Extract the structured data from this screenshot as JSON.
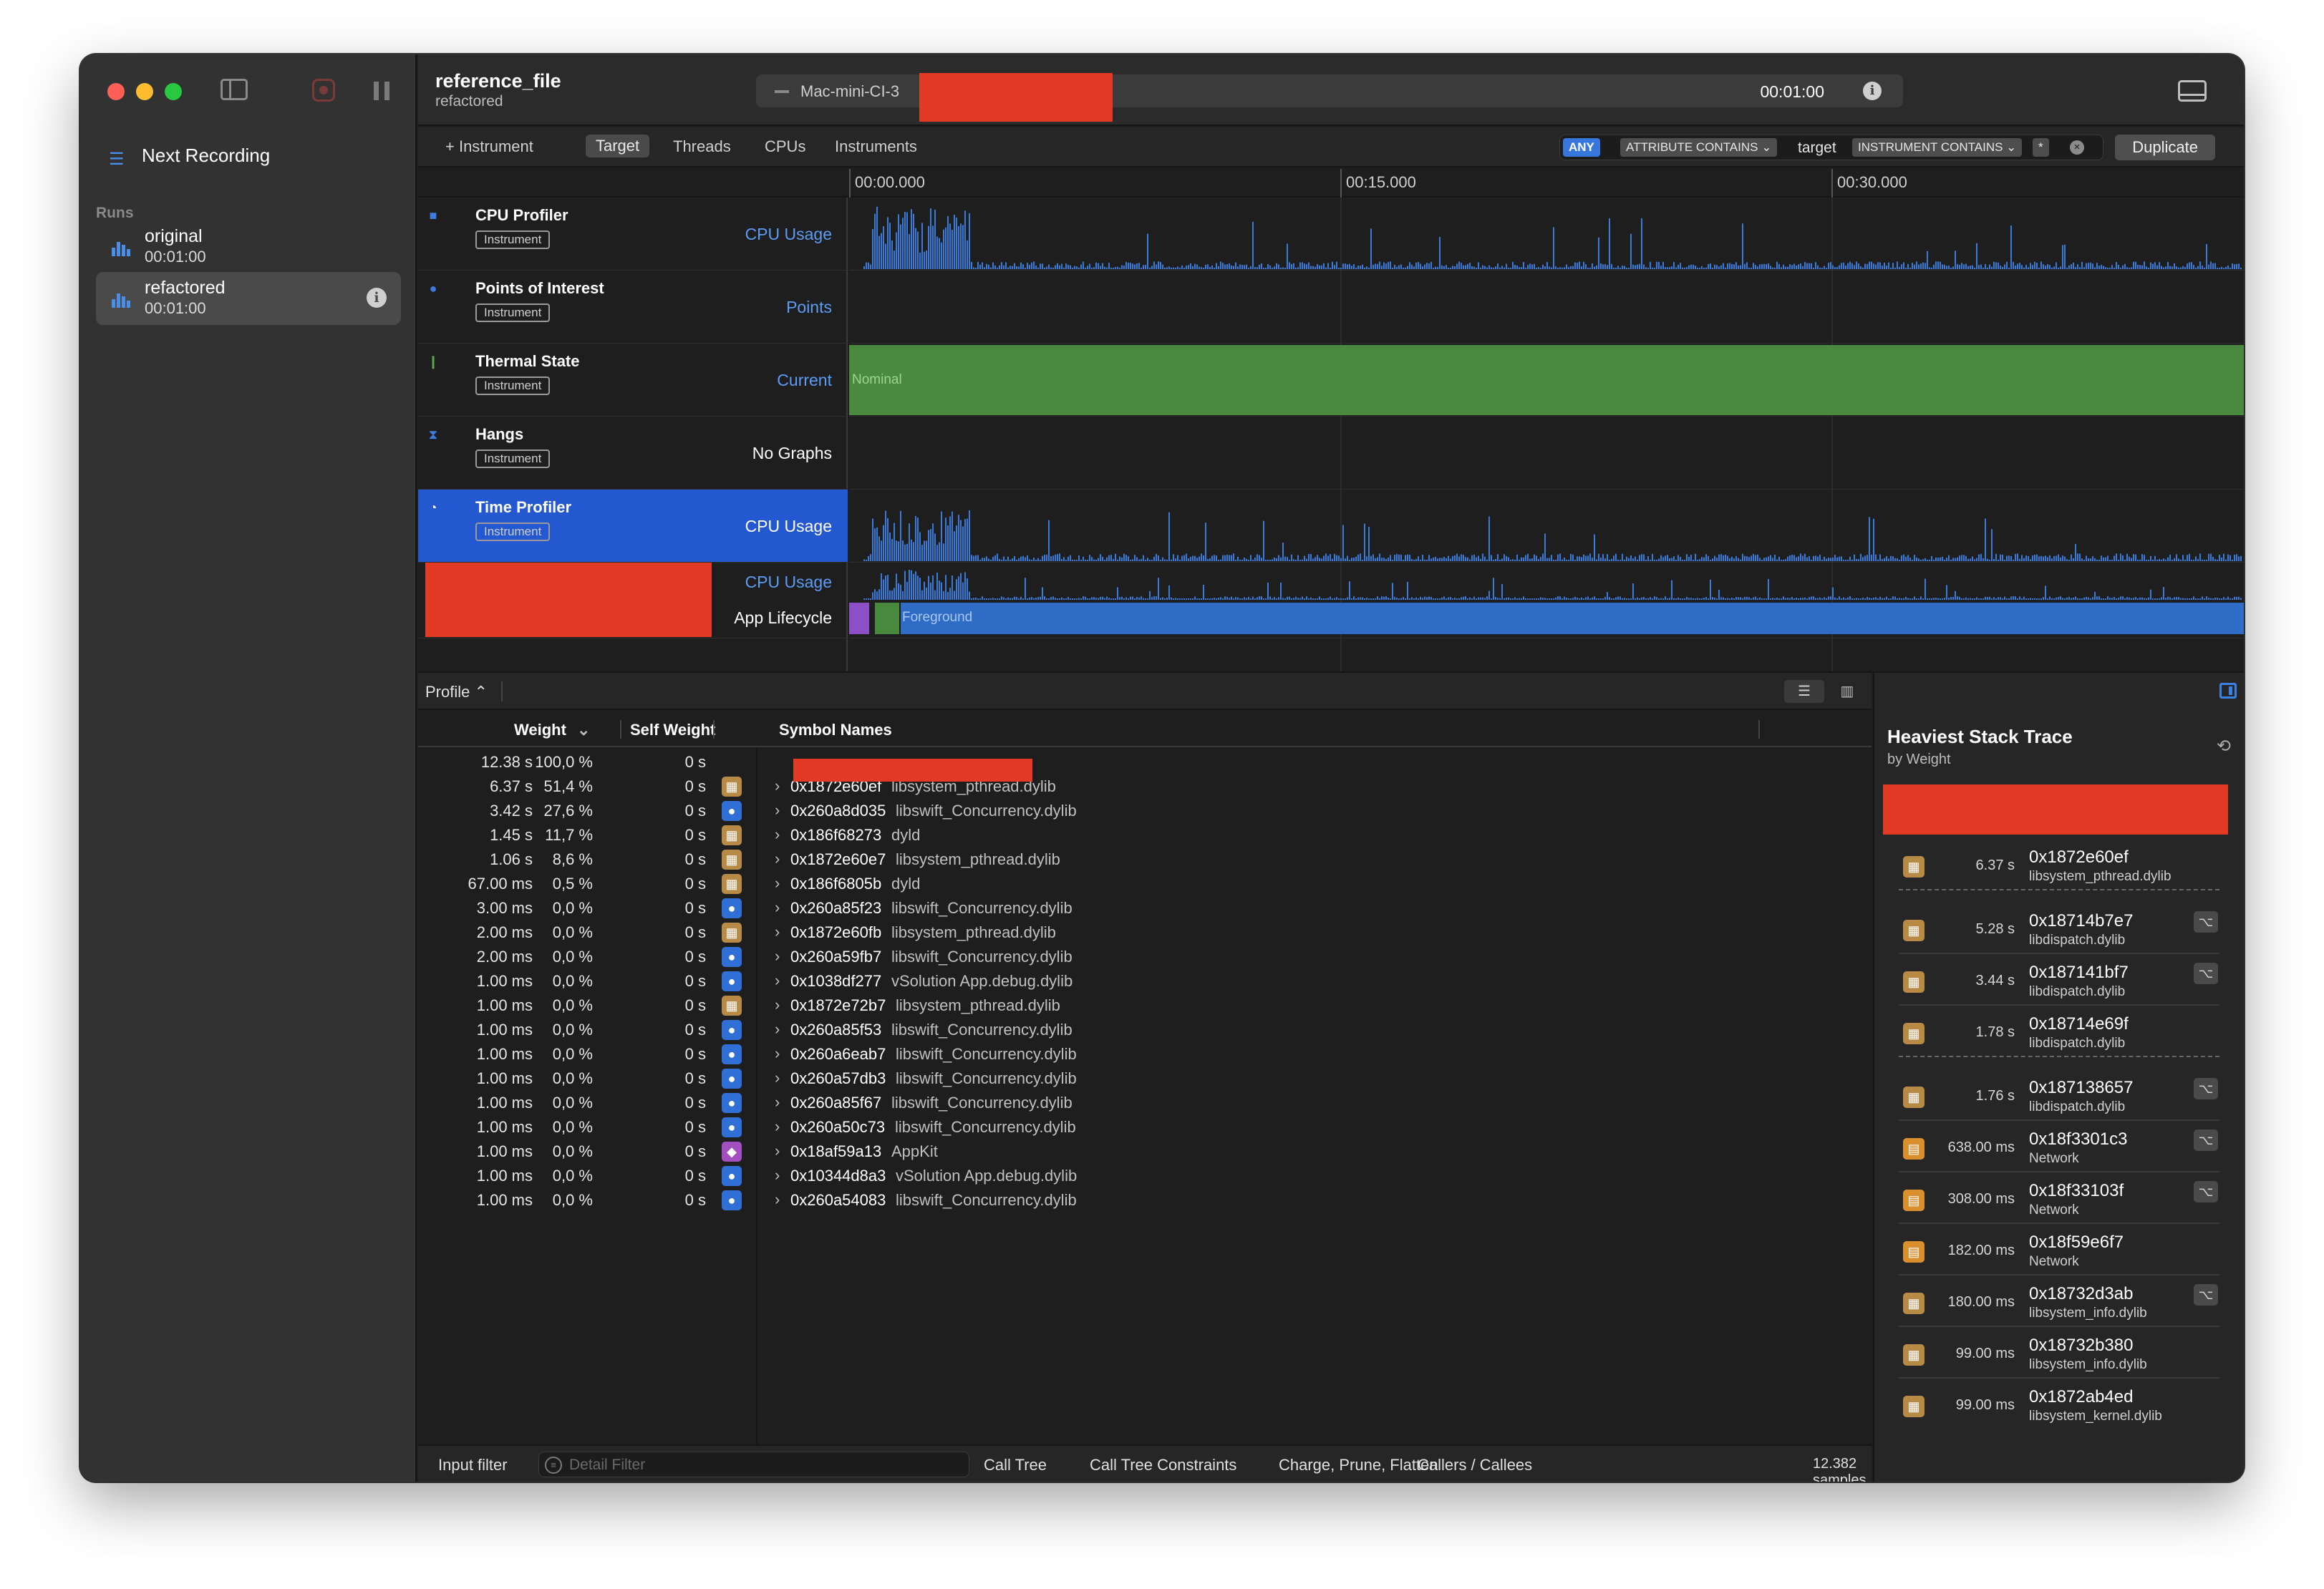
{
  "window": {
    "document_title": "reference_file",
    "document_subtitle": "refactored",
    "device": "Mac-mini-CI-3",
    "elapsed": "00:01:00",
    "info_glyph": "i"
  },
  "sidebar": {
    "next_recording": "Next Recording",
    "runs_header": "Runs",
    "runs": [
      {
        "name": "original",
        "time": "00:01:00"
      },
      {
        "name": "refactored",
        "time": "00:01:00"
      }
    ]
  },
  "toolbar": {
    "add_instrument": "+ Instrument",
    "tabs": [
      "Target",
      "Threads",
      "CPUs",
      "Instruments"
    ],
    "filter": {
      "any": "ANY",
      "attribute": "ATTRIBUTE CONTAINS ⌄",
      "value": "target",
      "instrument": "INSTRUMENT CONTAINS ⌄",
      "wildcard": "*"
    },
    "duplicate": "Duplicate"
  },
  "timeline": {
    "ticks": [
      "00:00.000",
      "00:15.000",
      "00:30.000"
    ],
    "tracks": [
      {
        "name": "CPU Profiler",
        "tag": "Instrument",
        "graph": "CPU Usage",
        "icon": "cpu-profiler-icon",
        "color": "#3c7ce0"
      },
      {
        "name": "Points of Interest",
        "tag": "Instrument",
        "graph": "Points",
        "icon": "map-pin-icon",
        "color": "#3c7ce0"
      },
      {
        "name": "Thermal State",
        "tag": "Instrument",
        "graph": "Current",
        "icon": "thermometer-icon",
        "color": "#5aa84a"
      },
      {
        "name": "Hangs",
        "tag": "Instrument",
        "graph": "No Graphs",
        "icon": "hourglass-icon",
        "color": "#3c7ce0"
      },
      {
        "name": "Time Profiler",
        "tag": "Instrument",
        "graph": "CPU Usage",
        "icon": "clock-icon",
        "color": "#ffffff"
      }
    ],
    "process_track": {
      "graph1": "CPU Usage",
      "graph2": "App Lifecycle"
    },
    "thermal_label": "Nominal",
    "lifecycle_label": "Foreground"
  },
  "profile": {
    "selector": "Profile ⌃",
    "columns": {
      "weight": "Weight",
      "self_weight": "Self Weight",
      "symbol": "Symbol Names"
    },
    "rows": [
      {
        "weight": "12.38 s",
        "pct": "100,0 %",
        "self": "0 s",
        "icon": "none",
        "addr": "",
        "lib": ""
      },
      {
        "weight": "6.37 s",
        "pct": "51,4 %",
        "self": "0 s",
        "icon": "lib",
        "addr": "0x1872e60ef",
        "lib": "libsystem_pthread.dylib"
      },
      {
        "weight": "3.42 s",
        "pct": "27,6 %",
        "self": "0 s",
        "icon": "user",
        "addr": "0x260a8d035",
        "lib": "libswift_Concurrency.dylib"
      },
      {
        "weight": "1.45 s",
        "pct": "11,7 %",
        "self": "0 s",
        "icon": "lib",
        "addr": "0x186f68273",
        "lib": "dyld"
      },
      {
        "weight": "1.06 s",
        "pct": "8,6 %",
        "self": "0 s",
        "icon": "lib",
        "addr": "0x1872e60e7",
        "lib": "libsystem_pthread.dylib"
      },
      {
        "weight": "67.00 ms",
        "pct": "0,5 %",
        "self": "0 s",
        "icon": "lib",
        "addr": "0x186f6805b",
        "lib": "dyld"
      },
      {
        "weight": "3.00 ms",
        "pct": "0,0 %",
        "self": "0 s",
        "icon": "user",
        "addr": "0x260a85f23",
        "lib": "libswift_Concurrency.dylib"
      },
      {
        "weight": "2.00 ms",
        "pct": "0,0 %",
        "self": "0 s",
        "icon": "lib",
        "addr": "0x1872e60fb",
        "lib": "libsystem_pthread.dylib"
      },
      {
        "weight": "2.00 ms",
        "pct": "0,0 %",
        "self": "0 s",
        "icon": "user",
        "addr": "0x260a59fb7",
        "lib": "libswift_Concurrency.dylib"
      },
      {
        "weight": "1.00 ms",
        "pct": "0,0 %",
        "self": "0 s",
        "icon": "user",
        "addr": "0x1038df277",
        "lib": "vSolution App.debug.dylib"
      },
      {
        "weight": "1.00 ms",
        "pct": "0,0 %",
        "self": "0 s",
        "icon": "lib",
        "addr": "0x1872e72b7",
        "lib": "libsystem_pthread.dylib"
      },
      {
        "weight": "1.00 ms",
        "pct": "0,0 %",
        "self": "0 s",
        "icon": "user",
        "addr": "0x260a85f53",
        "lib": "libswift_Concurrency.dylib"
      },
      {
        "weight": "1.00 ms",
        "pct": "0,0 %",
        "self": "0 s",
        "icon": "user",
        "addr": "0x260a6eab7",
        "lib": "libswift_Concurrency.dylib"
      },
      {
        "weight": "1.00 ms",
        "pct": "0,0 %",
        "self": "0 s",
        "icon": "user",
        "addr": "0x260a57db3",
        "lib": "libswift_Concurrency.dylib"
      },
      {
        "weight": "1.00 ms",
        "pct": "0,0 %",
        "self": "0 s",
        "icon": "user",
        "addr": "0x260a85f67",
        "lib": "libswift_Concurrency.dylib"
      },
      {
        "weight": "1.00 ms",
        "pct": "0,0 %",
        "self": "0 s",
        "icon": "user",
        "addr": "0x260a50c73",
        "lib": "libswift_Concurrency.dylib"
      },
      {
        "weight": "1.00 ms",
        "pct": "0,0 %",
        "self": "0 s",
        "icon": "kit",
        "addr": "0x18af59a13",
        "lib": "AppKit"
      },
      {
        "weight": "1.00 ms",
        "pct": "0,0 %",
        "self": "0 s",
        "icon": "user",
        "addr": "0x10344d8a3",
        "lib": "vSolution App.debug.dylib"
      },
      {
        "weight": "1.00 ms",
        "pct": "0,0 %",
        "self": "0 s",
        "icon": "user",
        "addr": "0x260a54083",
        "lib": "libswift_Concurrency.dylib"
      }
    ]
  },
  "bottom_bar": {
    "input_filter": "Input filter",
    "detail_placeholder": "Detail Filter",
    "call_tree": "Call Tree",
    "constraints": "Call Tree Constraints",
    "charge": "Charge, Prune, Flatten",
    "callers": "Callers / Callees",
    "samples": "12.382 samples"
  },
  "inspector": {
    "title": "Heaviest Stack Trace",
    "subtitle": "by Weight",
    "frames": [
      {
        "time": "6.37 s",
        "addr": "0x1872e60ef",
        "lib": "libsystem_pthread.dylib",
        "icon": "lib",
        "fold": false,
        "sep": "dash"
      },
      {
        "time": "5.28 s",
        "addr": "0x18714b7e7",
        "lib": "libdispatch.dylib",
        "icon": "lib",
        "fold": true,
        "sep": "solid"
      },
      {
        "time": "3.44 s",
        "addr": "0x187141bf7",
        "lib": "libdispatch.dylib",
        "icon": "lib",
        "fold": true,
        "sep": "solid"
      },
      {
        "time": "1.78 s",
        "addr": "0x18714e69f",
        "lib": "libdispatch.dylib",
        "icon": "lib",
        "fold": false,
        "sep": "dash"
      },
      {
        "time": "1.76 s",
        "addr": "0x187138657",
        "lib": "libdispatch.dylib",
        "icon": "lib",
        "fold": true,
        "sep": "solid"
      },
      {
        "time": "638.00 ms",
        "addr": "0x18f3301c3",
        "lib": "Network",
        "icon": "net",
        "fold": true,
        "sep": "solid"
      },
      {
        "time": "308.00 ms",
        "addr": "0x18f33103f",
        "lib": "Network",
        "icon": "net",
        "fold": true,
        "sep": "solid"
      },
      {
        "time": "182.00 ms",
        "addr": "0x18f59e6f7",
        "lib": "Network",
        "icon": "net",
        "fold": false,
        "sep": "solid"
      },
      {
        "time": "180.00 ms",
        "addr": "0x18732d3ab",
        "lib": "libsystem_info.dylib",
        "icon": "lib",
        "fold": true,
        "sep": "solid"
      },
      {
        "time": "99.00 ms",
        "addr": "0x18732b380",
        "lib": "libsystem_info.dylib",
        "icon": "lib",
        "fold": false,
        "sep": "solid"
      },
      {
        "time": "99.00 ms",
        "addr": "0x1872ab4ed",
        "lib": "libsystem_kernel.dylib",
        "icon": "lib",
        "fold": false,
        "sep": "none"
      }
    ]
  },
  "colors": {
    "accent": "#2458d1",
    "graph_blue": "#2f6cc6",
    "thermal_green": "#4a8a3e",
    "redaction": "#e23a25"
  }
}
